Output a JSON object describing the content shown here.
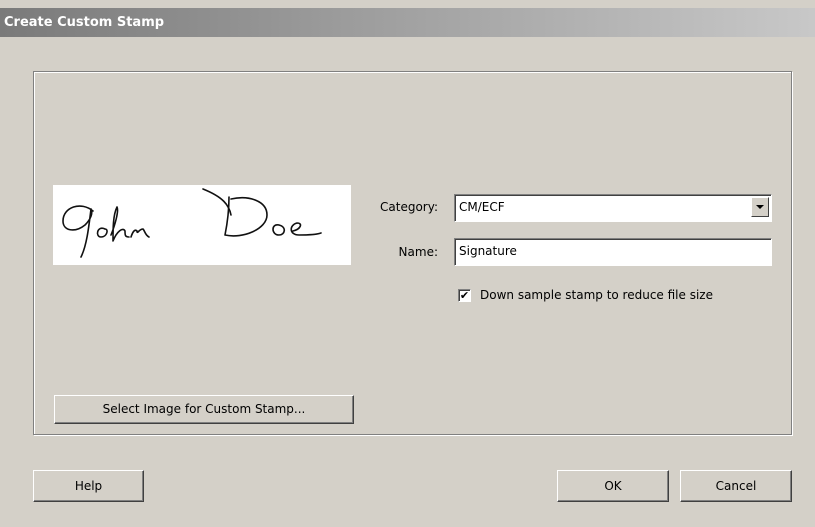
{
  "window": {
    "title": "Create Custom Stamp"
  },
  "preview": {
    "signature_text": "John Doe"
  },
  "category": {
    "label": "Category:",
    "value": "CM/ECF"
  },
  "name": {
    "label": "Name:",
    "value": "Signature"
  },
  "downsample": {
    "label": "Down sample stamp to reduce file size",
    "checked": true,
    "check_glyph": "✔"
  },
  "buttons": {
    "select_image": "Select Image for Custom Stamp...",
    "help": "Help",
    "ok": "OK",
    "cancel": "Cancel"
  },
  "icons": {
    "combo_arrow": "chevron-down-icon"
  }
}
